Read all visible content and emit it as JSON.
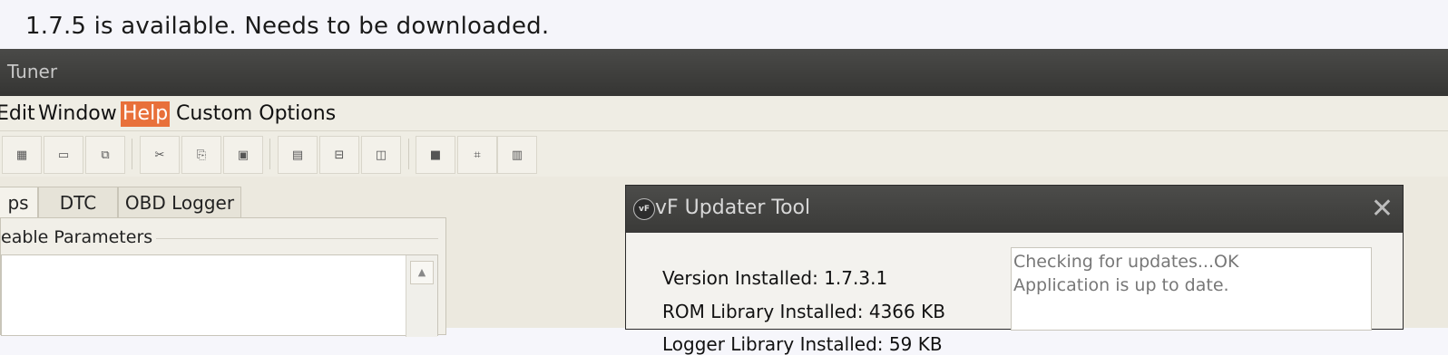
{
  "caption": "1.7.5 is available. Needs to be downloaded.",
  "app": {
    "title": "Tuner",
    "menu": [
      "Edit",
      "Window",
      "Help",
      "Custom Options"
    ],
    "active_menu": "Help",
    "toolbar_icons": [
      "open-icon",
      "save-icon",
      "save-as-icon",
      "cut-icon",
      "copy-icon",
      "paste-icon",
      "compare-icon",
      "split-horizontal-icon",
      "split-vertical-icon",
      "square-icon",
      "fit-icon",
      "table-icon"
    ],
    "tabs": [
      "ps",
      "DTC",
      "OBD Logger"
    ],
    "group_label": "eable Parameters",
    "accent_color": "#e8703a"
  },
  "dialog": {
    "title": "vF Updater Tool",
    "logo": "vF",
    "close": "✕",
    "version_installed": "Version Installed: 1.7.3.1",
    "rom_library": "ROM Library Installed: 4366 KB",
    "logger_library": "Logger Library Installed: 59 KB",
    "log_lines": [
      "Checking for updates...OK",
      "Application is up to date."
    ]
  }
}
